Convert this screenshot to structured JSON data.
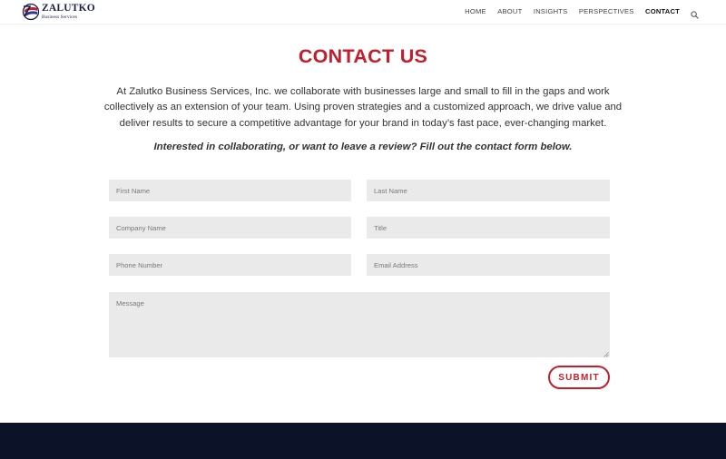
{
  "brand": {
    "name": "ZALUTKO",
    "tagline": "Business Services"
  },
  "nav": {
    "items": [
      "HOME",
      "ABOUT",
      "INSIGHTS",
      "PERSPECTIVES",
      "CONTACT"
    ],
    "active": "CONTACT",
    "search_icon": "search-icon"
  },
  "page": {
    "title": "CONTACT US",
    "intro": "At Zalutko Business Services, Inc. we collaborate with businesses large and small to fill in the gaps and work collectively as an extension of your team. Using proven strategies and a customized approach, we drive value and deliver results to secure a competitive advantage for your brand in today’s fast pace, ever-changing market.",
    "cta": "Interested in collaborating, or want to leave a review? Fill out the contact form below."
  },
  "form": {
    "first_name": {
      "placeholder": "First Name",
      "value": ""
    },
    "last_name": {
      "placeholder": "Last Name",
      "value": ""
    },
    "company_name": {
      "placeholder": "Company Name",
      "value": ""
    },
    "title": {
      "placeholder": "Title",
      "value": ""
    },
    "phone_number": {
      "placeholder": "Phone Number",
      "value": ""
    },
    "email_address": {
      "placeholder": "Email Address",
      "value": ""
    },
    "message": {
      "placeholder": "Message",
      "value": ""
    },
    "submit_label": "SUBMIT"
  },
  "colors": {
    "accent": "#c41e2a",
    "navy": "#1a1f4a",
    "footer": "#0c1329",
    "field_bg": "#eaeaea"
  }
}
